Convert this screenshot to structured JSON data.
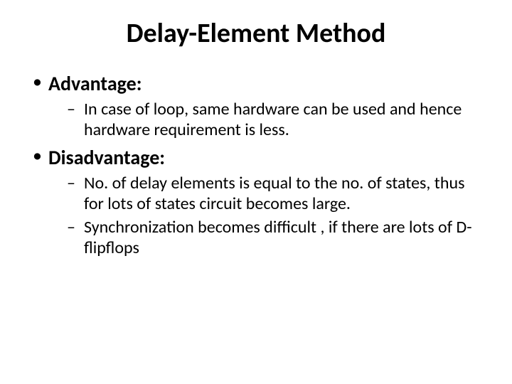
{
  "title": "Delay-Element Method",
  "bullets": [
    {
      "label": "Advantage:",
      "sub": [
        "In case of loop, same hardware can be used and hence hardware requirement is less."
      ]
    },
    {
      "label": "Disadvantage:",
      "sub": [
        "No. of delay elements is equal to the no. of states, thus for lots of states circuit becomes large.",
        "Synchronization becomes difficult , if there are lots of D-flipflops"
      ]
    }
  ]
}
